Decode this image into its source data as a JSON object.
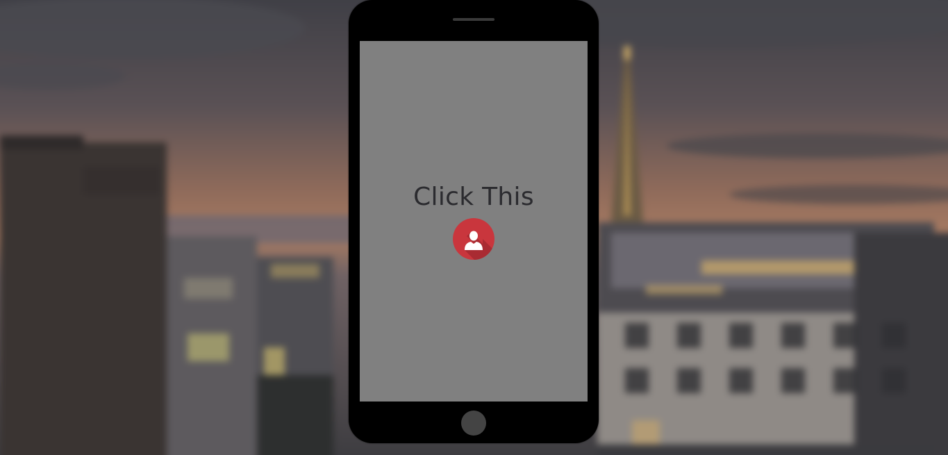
{
  "screen": {
    "title": "Click This",
    "button_icon": "user-icon"
  },
  "colors": {
    "phone_body": "#000000",
    "screen_background": "#808080",
    "title_text": "#2b2b2f",
    "button_background": "#c9363d"
  }
}
